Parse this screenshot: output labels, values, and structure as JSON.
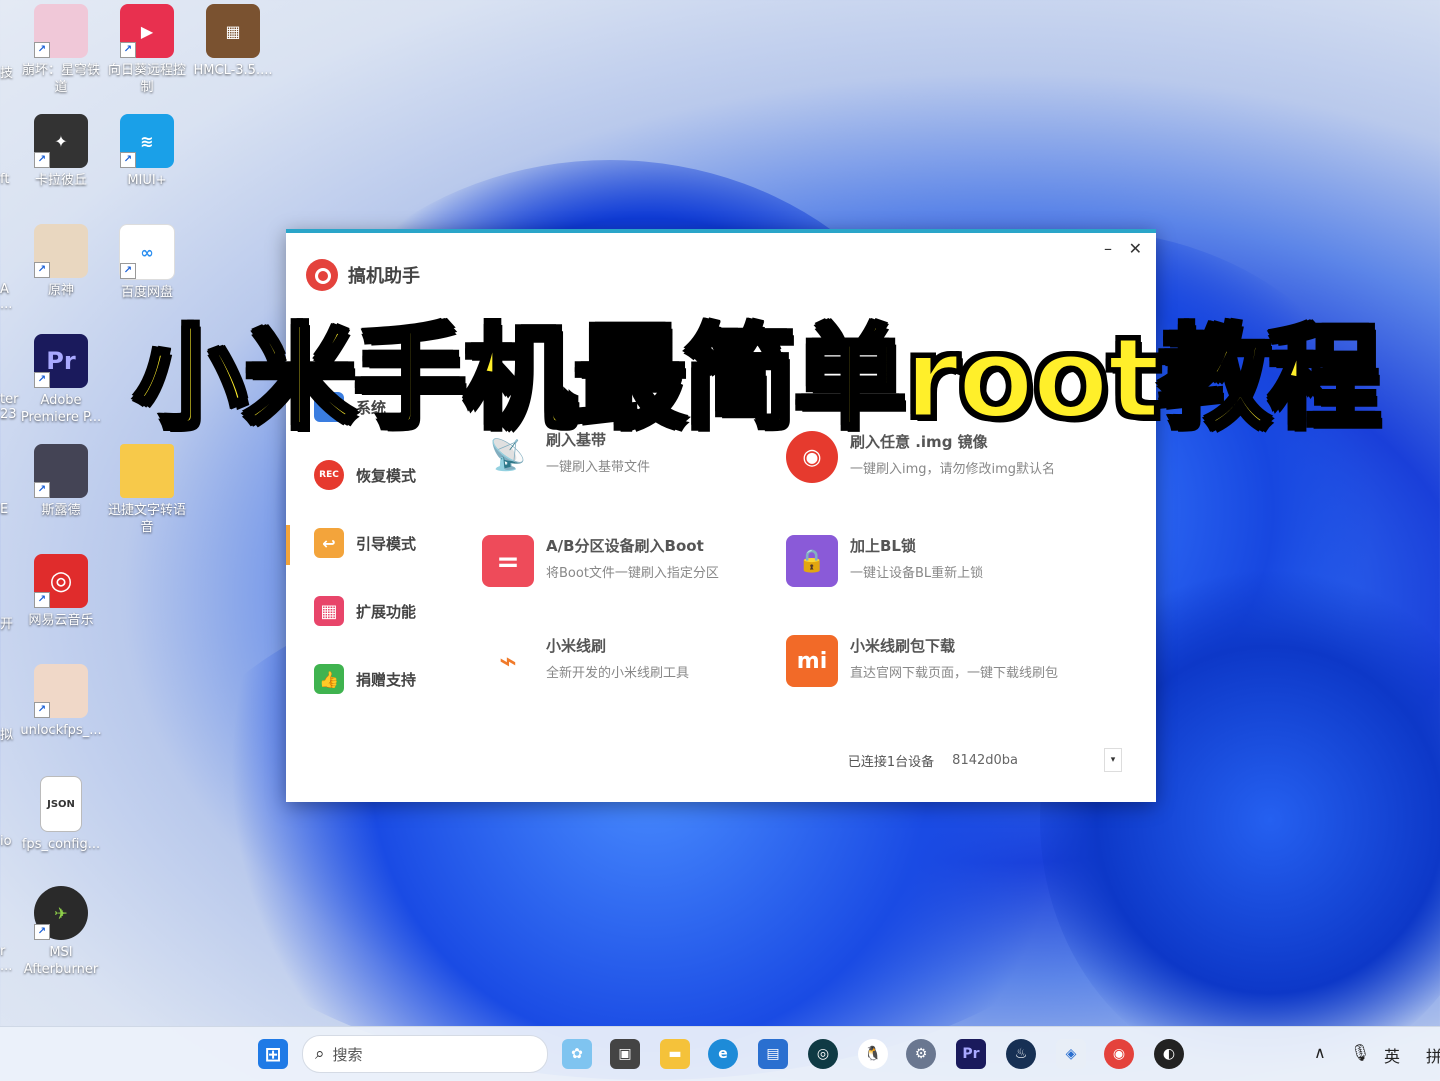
{
  "desktop": {
    "icons": [
      {
        "name": "honkai-star-rail",
        "label": "崩坏：星穹铁\n道",
        "color": "#f0c8d8"
      },
      {
        "name": "sunlogin",
        "label": "向日葵远程控\n制",
        "color": "#e8304f"
      },
      {
        "name": "hmcl",
        "label": "HMCL-3.5....",
        "color": "#7a5230"
      },
      {
        "name": "karlaboqiu",
        "label": "卡拉彼丘",
        "color": "#333"
      },
      {
        "name": "miui-plus",
        "label": "MIUI+",
        "color": "#1aa0e8"
      },
      {
        "name": "genshin",
        "label": "原神",
        "color": "#e9d7c0"
      },
      {
        "name": "baidu-netdisk",
        "label": "百度网盘",
        "color": "#ffffff"
      },
      {
        "name": "premiere",
        "label": "Adobe\nPremiere P...",
        "color": "#1a1a5c"
      },
      {
        "name": "snowbreak",
        "label": "斯露德",
        "color": "#445"
      },
      {
        "name": "folder",
        "label": "迅捷文字转语\n音",
        "color": "#f7c94a"
      },
      {
        "name": "netease-music",
        "label": "网易云音乐",
        "color": "#e02c2c"
      },
      {
        "name": "unlockfps",
        "label": "unlockfps_...",
        "color": "#f0d8c8"
      },
      {
        "name": "fps-config",
        "label": "fps_config...",
        "color": "#ffffff"
      },
      {
        "name": "msi-afterburner",
        "label": "MSI\nAfterburner",
        "color": "#2a2a2a"
      }
    ],
    "edge_labels": [
      "技",
      "ft",
      "A\n...",
      "ter\n23",
      "E",
      "开",
      "拟",
      "io",
      "r\n..."
    ]
  },
  "window": {
    "title": "搞机助手",
    "minimize": "–",
    "close": "✕",
    "sidebar": [
      {
        "label": "系统",
        "icon": "android-icon",
        "color": "#3a7de0",
        "active": false
      },
      {
        "label": "恢复模式",
        "icon": "rec-icon",
        "color": "#e63a2e",
        "active": false
      },
      {
        "label": "引导模式",
        "icon": "back-arrow-icon",
        "color": "#f3a43b",
        "active": true
      },
      {
        "label": "扩展功能",
        "icon": "grid-icon",
        "color": "#e8456a",
        "active": false
      },
      {
        "label": "捐赠支持",
        "icon": "thumbs-up-icon",
        "color": "#3fb34f",
        "active": false
      }
    ],
    "features": [
      {
        "title": "刷入基带",
        "desc": "一键刷入基带文件",
        "icon": "antenna-icon",
        "color": "#e8456a"
      },
      {
        "title": "刷入任意 .img 镜像",
        "desc": "一键刷入img，请勿修改img默认名",
        "icon": "disc-icon",
        "color": "#e63a2e"
      },
      {
        "title": "A/B分区设备刷入Boot",
        "desc": "将Boot文件一键刷入指定分区",
        "icon": "equals-icon",
        "color": "#ee4b5a"
      },
      {
        "title": "加上BL锁",
        "desc": "一键让设备BL重新上锁",
        "icon": "lock-icon",
        "color": "#8a5ad8"
      },
      {
        "title": "小米线刷",
        "desc": "全新开发的小米线刷工具",
        "icon": "usb-cable-icon",
        "color": "#f07a2a"
      },
      {
        "title": "小米线刷包下载",
        "desc": "直达官网下载页面，一键下载线刷包",
        "icon": "mi-logo-icon",
        "color": "#f26a28"
      }
    ],
    "status": {
      "connected": "已连接1台设备",
      "device": "8142d0ba",
      "dropdown_glyph": "▾"
    }
  },
  "overlay_title": "小米手机最简单root教程",
  "taskbar": {
    "search_placeholder": "搜索",
    "search_icon": "⌕",
    "tray": {
      "chevron": "∧",
      "mic": "🎙",
      "ime": "英",
      "ime2": "拼"
    }
  }
}
